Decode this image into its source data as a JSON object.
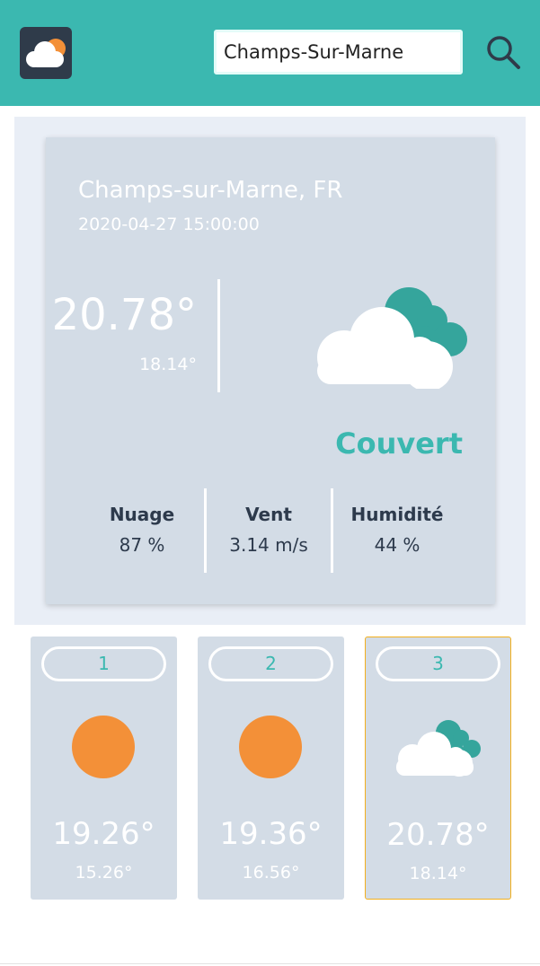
{
  "header": {
    "logo_icon": "cloud-sun-icon",
    "search": {
      "value": "Champs-Sur-Marne",
      "icon": "search-icon"
    },
    "brand_color": "#3bb8b0"
  },
  "current": {
    "location": "Champs-sur-Marne, FR",
    "datetime": "2020-04-27 15:00:00",
    "temperature": "20.78°",
    "temp_min": "18.14°",
    "condition": "Couvert",
    "icon": "cloud-overcast-icon",
    "stats": [
      {
        "label": "Nuage",
        "value": "87 %"
      },
      {
        "label": "Vent",
        "value": "3.14 m/s"
      },
      {
        "label": "Humidité",
        "value": "44 %"
      }
    ]
  },
  "forecast": [
    {
      "day": "1",
      "icon": "sun-icon",
      "temperature": "19.26°",
      "temp_min": "15.26°",
      "selected": false
    },
    {
      "day": "2",
      "icon": "sun-icon",
      "temperature": "19.36°",
      "temp_min": "16.56°",
      "selected": false
    },
    {
      "day": "3",
      "icon": "cloud-overcast-icon",
      "temperature": "20.78°",
      "temp_min": "18.14°",
      "selected": true
    }
  ],
  "colors": {
    "accent": "#3bb8b0",
    "sun": "#f39038",
    "selected_border": "#f2b01e",
    "card": "#d3dce6"
  }
}
